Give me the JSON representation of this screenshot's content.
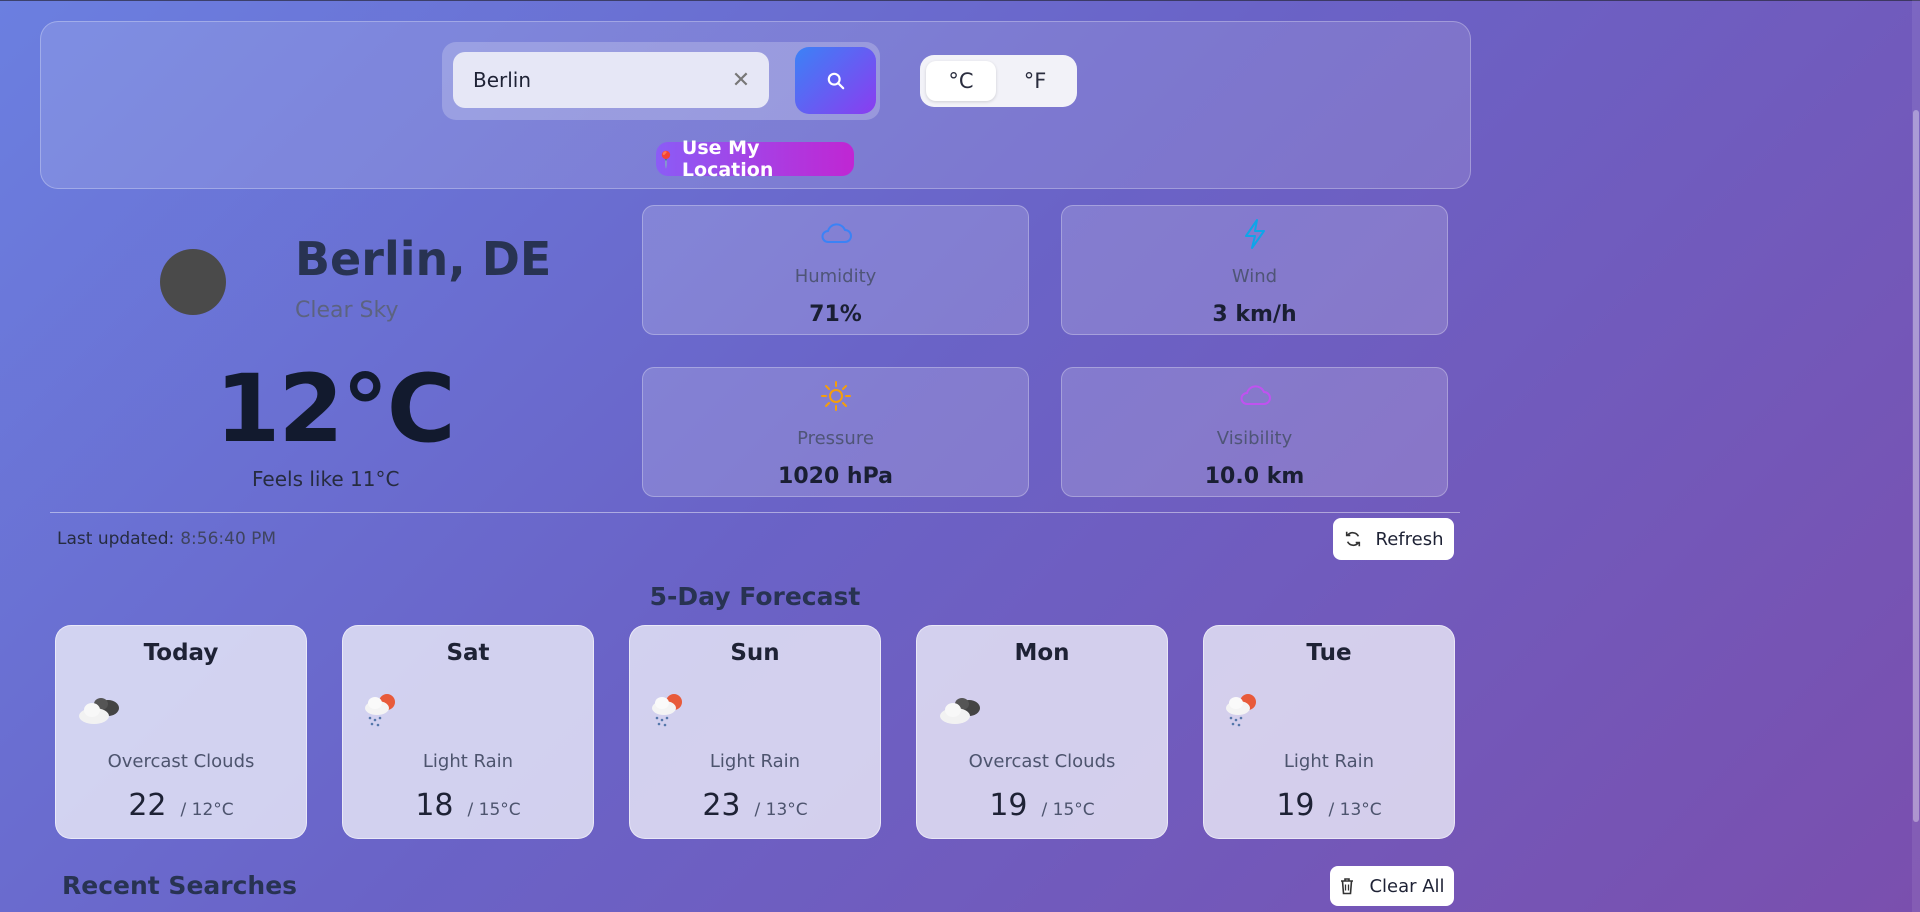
{
  "search": {
    "query": "Berlin",
    "units": [
      "°C",
      "°F"
    ],
    "selected_unit": "°C",
    "location_button": "Use My Location"
  },
  "current": {
    "city": "Berlin, DE",
    "condition": "Clear Sky",
    "temperature": "12°C",
    "feels_like": "Feels like 11°C"
  },
  "stats": [
    {
      "label": "Humidity",
      "value": "71%",
      "icon": "cloud-icon",
      "color": "#3b82f6"
    },
    {
      "label": "Wind",
      "value": "3 km/h",
      "icon": "lightning-icon",
      "color": "#0ea5e9"
    },
    {
      "label": "Pressure",
      "value": "1020 hPa",
      "icon": "sun-icon",
      "color": "#f59e0b"
    },
    {
      "label": "Visibility",
      "value": "10.0 km",
      "icon": "cloud-icon",
      "color": "#c052f0"
    }
  ],
  "update": {
    "label": "Last updated:",
    "time": "8:56:40 PM",
    "refresh_label": "Refresh"
  },
  "forecast": {
    "title": "5-Day Forecast",
    "days": [
      {
        "day": "Today",
        "condition": "Overcast Clouds",
        "high": "22",
        "low": "/ 12°C",
        "icon": "overcast-clouds-icon"
      },
      {
        "day": "Sat",
        "condition": "Light Rain",
        "high": "18",
        "low": "/ 15°C",
        "icon": "light-rain-icon"
      },
      {
        "day": "Sun",
        "condition": "Light Rain",
        "high": "23",
        "low": "/ 13°C",
        "icon": "light-rain-icon"
      },
      {
        "day": "Mon",
        "condition": "Overcast Clouds",
        "high": "19",
        "low": "/ 15°C",
        "icon": "overcast-clouds-icon"
      },
      {
        "day": "Tue",
        "condition": "Light Rain",
        "high": "19",
        "low": "/ 13°C",
        "icon": "light-rain-icon"
      }
    ]
  },
  "recent": {
    "title": "Recent Searches",
    "clear_label": "Clear All"
  }
}
